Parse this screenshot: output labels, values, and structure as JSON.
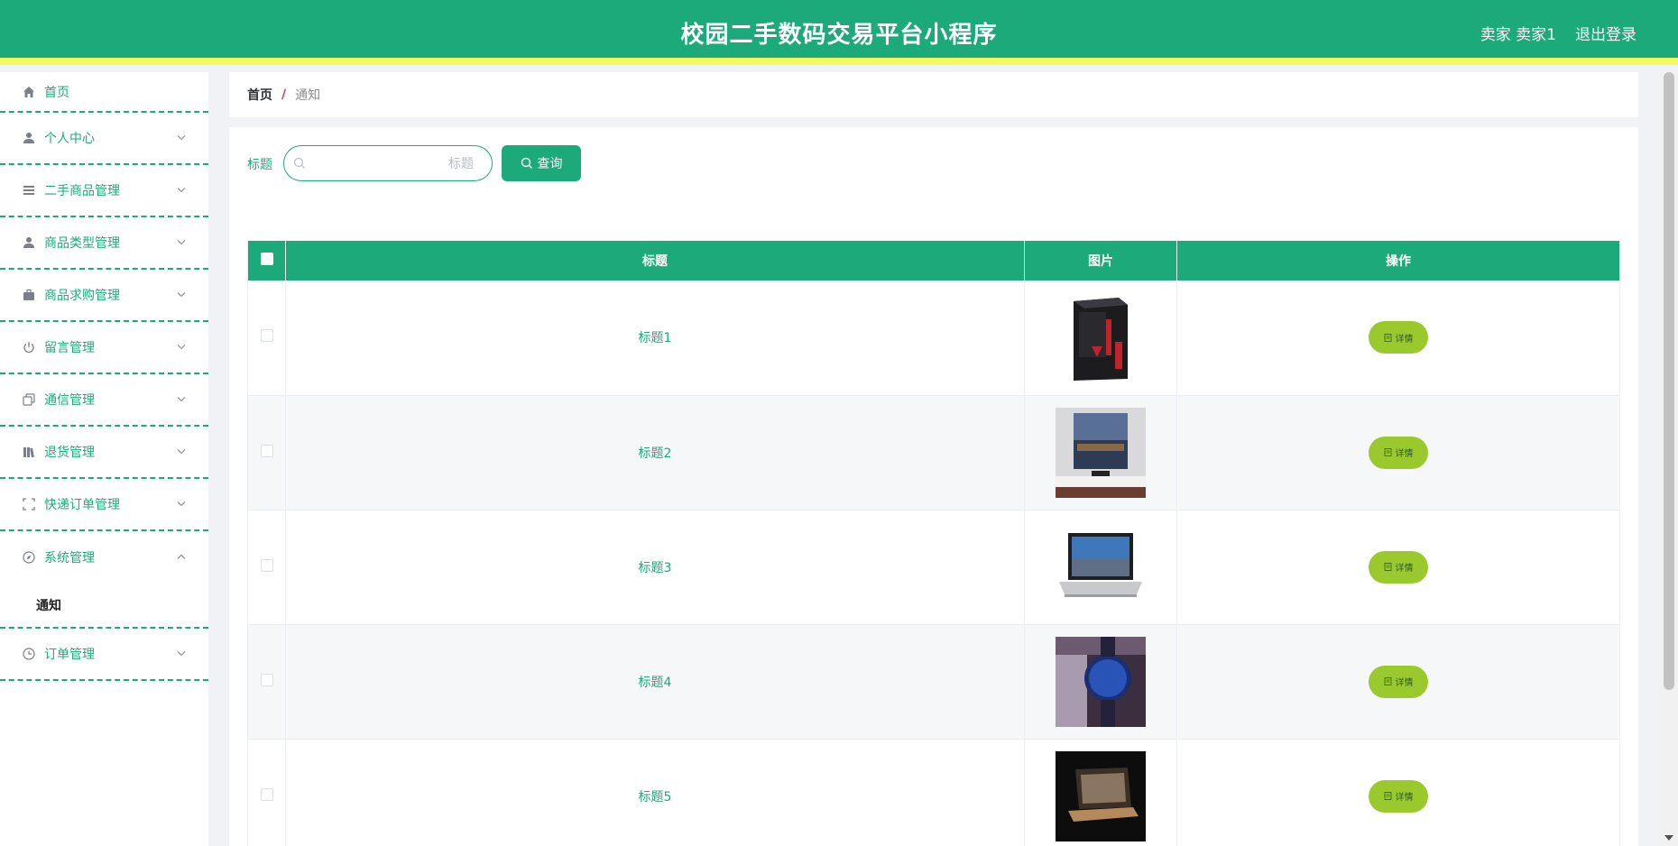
{
  "header": {
    "title": "校园二手数码交易平台小程序",
    "user": "卖家 卖家1",
    "logout": "退出登录",
    "brand_color": "#1daa7a",
    "accent_color": "#f3fb5c"
  },
  "sidebar": {
    "items": [
      {
        "label": "首页",
        "icon": "home-icon"
      },
      {
        "label": "个人中心",
        "icon": "user-icon"
      },
      {
        "label": "二手商品管理",
        "icon": "list-icon"
      },
      {
        "label": "商品类型管理",
        "icon": "user-icon"
      },
      {
        "label": "商品求购管理",
        "icon": "briefcase-icon"
      },
      {
        "label": "留言管理",
        "icon": "power-icon"
      },
      {
        "label": "通信管理",
        "icon": "copy-icon"
      },
      {
        "label": "退货管理",
        "icon": "books-icon"
      },
      {
        "label": "快递订单管理",
        "icon": "fullscreen-icon"
      },
      {
        "label": "系统管理",
        "icon": "compass-icon"
      },
      {
        "label": "订单管理",
        "icon": "clock-icon"
      }
    ],
    "submenu": {
      "label": "通知"
    }
  },
  "breadcrumb": {
    "home": "首页",
    "separator": "/",
    "current": "通知"
  },
  "search": {
    "label": "标题",
    "placeholder": "标题",
    "button": "查询"
  },
  "table": {
    "headers": {
      "title": "标题",
      "image": "图片",
      "action": "操作"
    },
    "rows": [
      {
        "title": "标题1",
        "image": "pc-tower",
        "action": "详情"
      },
      {
        "title": "标题2",
        "image": "tv-wall",
        "action": "详情"
      },
      {
        "title": "标题3",
        "image": "laptop",
        "action": "详情"
      },
      {
        "title": "标题4",
        "image": "wristwatch",
        "action": "详情"
      },
      {
        "title": "标题5",
        "image": "dark-laptop",
        "action": "详情"
      }
    ]
  }
}
